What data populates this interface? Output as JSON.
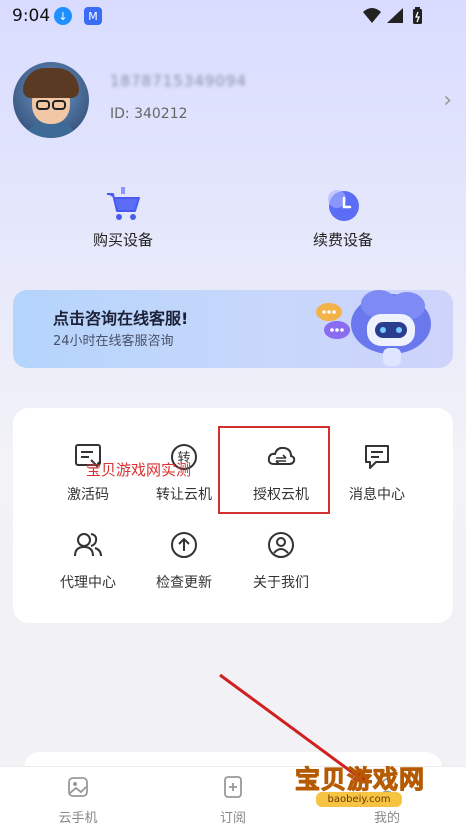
{
  "status_bar": {
    "time": "9:04"
  },
  "profile": {
    "username": "1878715349094",
    "user_id": "ID: 340212"
  },
  "actions": [
    {
      "label": "购买设备"
    },
    {
      "label": "续费设备"
    }
  ],
  "banner": {
    "title": "点击咨询在线客服!",
    "subtitle": "24小时在线客服咨询"
  },
  "menu": [
    {
      "label": "激活码",
      "icon": "activation-code-icon"
    },
    {
      "label": "转让云机",
      "icon": "transfer-icon"
    },
    {
      "label": "授权云机",
      "icon": "cloud-authorize-icon"
    },
    {
      "label": "消息中心",
      "icon": "message-icon"
    },
    {
      "label": "代理中心",
      "icon": "agent-icon"
    },
    {
      "label": "检查更新",
      "icon": "update-icon"
    },
    {
      "label": "关于我们",
      "icon": "about-icon"
    }
  ],
  "transfer_icon_char": "转",
  "watermark": {
    "overlay_text": "宝贝游戏网实测",
    "logo": "宝贝游戏网",
    "url": "baobeiy.com"
  },
  "tabs": [
    {
      "label": "云手机"
    },
    {
      "label": "订阅"
    },
    {
      "label": "我的"
    }
  ],
  "colors": {
    "accent": "#4a5cf0",
    "highlight": "#d03030"
  }
}
